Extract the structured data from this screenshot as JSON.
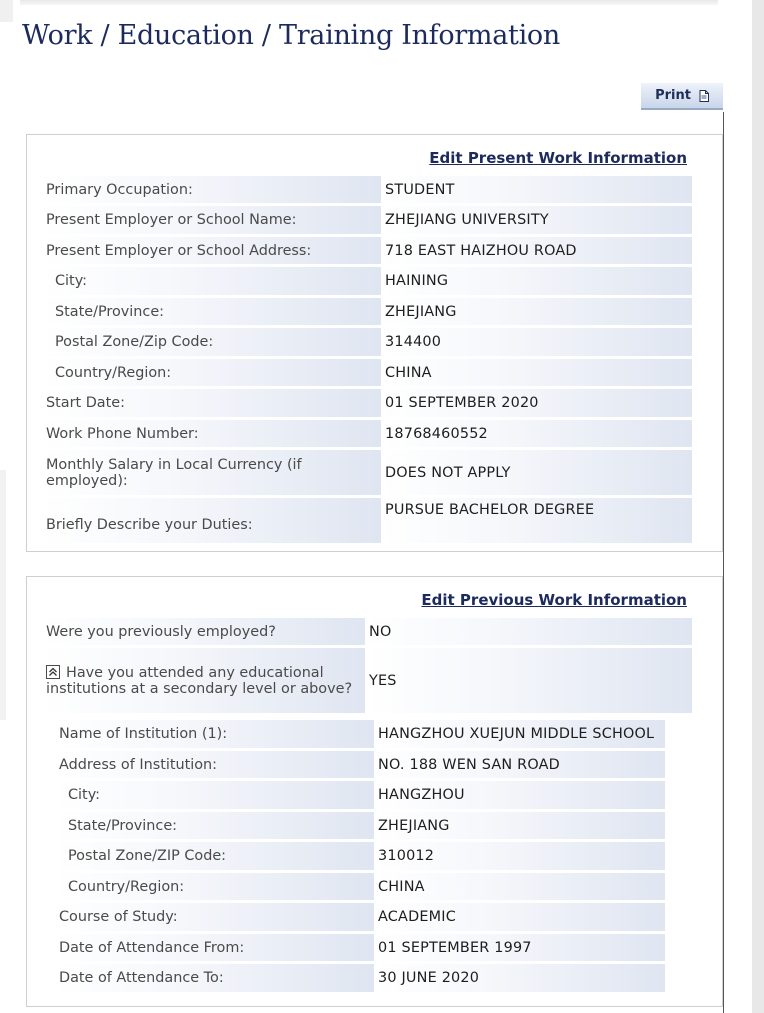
{
  "page": {
    "title": "Work / Education / Training Information"
  },
  "print": {
    "label": "Print",
    "icon": "document-icon"
  },
  "present_work": {
    "edit_link": "Edit Present Work Information",
    "rows": [
      {
        "label": "Primary Occupation:",
        "value": "STUDENT"
      },
      {
        "label": "Present Employer or School Name:",
        "value": "ZHEJIANG UNIVERSITY"
      },
      {
        "label": "Present Employer or School Address:",
        "value": "718 EAST HAIZHOU ROAD"
      },
      {
        "label": "City:",
        "value": "HAINING"
      },
      {
        "label": "State/Province:",
        "value": "ZHEJIANG"
      },
      {
        "label": "Postal Zone/Zip Code:",
        "value": "314400"
      },
      {
        "label": "Country/Region:",
        "value": "CHINA"
      },
      {
        "label": "Start Date:",
        "value": "01 SEPTEMBER 2020"
      },
      {
        "label": "Work Phone Number:",
        "value": "18768460552"
      },
      {
        "label": "Monthly Salary in Local Currency (if employed):",
        "value": "DOES NOT APPLY"
      },
      {
        "label": "Briefly Describe your Duties:",
        "value": "PURSUE BACHELOR DEGREE"
      }
    ]
  },
  "previous_work": {
    "edit_link": "Edit Previous Work Information",
    "rows": [
      {
        "label": "Were you previously employed?",
        "value": "NO"
      },
      {
        "label": "Have you attended any educational institutions at a secondary level or above?",
        "value": "YES"
      }
    ],
    "institution": [
      {
        "label": "Name of Institution (1):",
        "value": "HANGZHOU XUEJUN MIDDLE SCHOOL"
      },
      {
        "label": "Address of Institution:",
        "value": "NO. 188 WEN SAN ROAD"
      },
      {
        "label": "City:",
        "value": "HANGZHOU"
      },
      {
        "label": "State/Province:",
        "value": "ZHEJIANG"
      },
      {
        "label": "Postal Zone/ZIP Code:",
        "value": "310012"
      },
      {
        "label": "Country/Region:",
        "value": "CHINA"
      },
      {
        "label": "Course of Study:",
        "value": "ACADEMIC"
      },
      {
        "label": "Date of Attendance From:",
        "value": "01 SEPTEMBER 1997"
      },
      {
        "label": "Date of Attendance To:",
        "value": "30 JUNE 2020"
      }
    ]
  },
  "colors": {
    "title": "#1c2a5c",
    "link": "#1c2a5c",
    "row_gradient_end": "#dfe5f1"
  }
}
